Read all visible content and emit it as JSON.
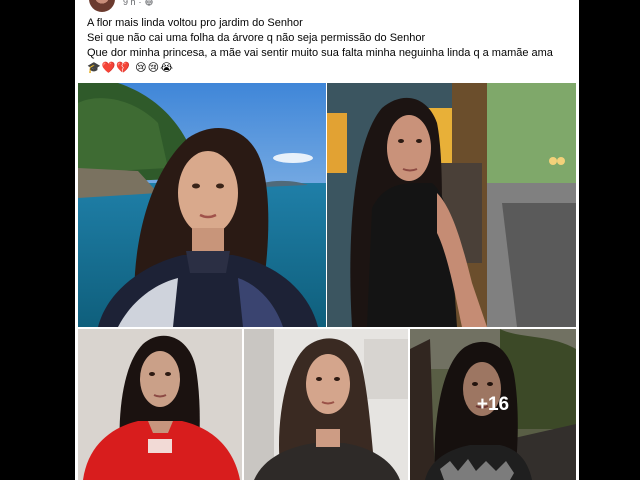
{
  "post": {
    "time": "9 h",
    "separator": "·",
    "privacy_icon": "globe-icon",
    "text_lines": [
      "A flor mais linda voltou pro jardim do Senhor",
      "Sei que não cai uma folha da árvore q não seja permissão do Senhor",
      "Que dor minha princesa, a mãe vai sentir muito sua falta minha neguinha linda q a mamãe ama"
    ],
    "emojis": "🎓❤️💔 😢😢😭"
  },
  "gallery": {
    "photo_count": 5,
    "more_label": "+16"
  },
  "colors": {
    "background": "#000000",
    "card": "#ffffff",
    "text": "#050505",
    "meta": "#65676b"
  }
}
